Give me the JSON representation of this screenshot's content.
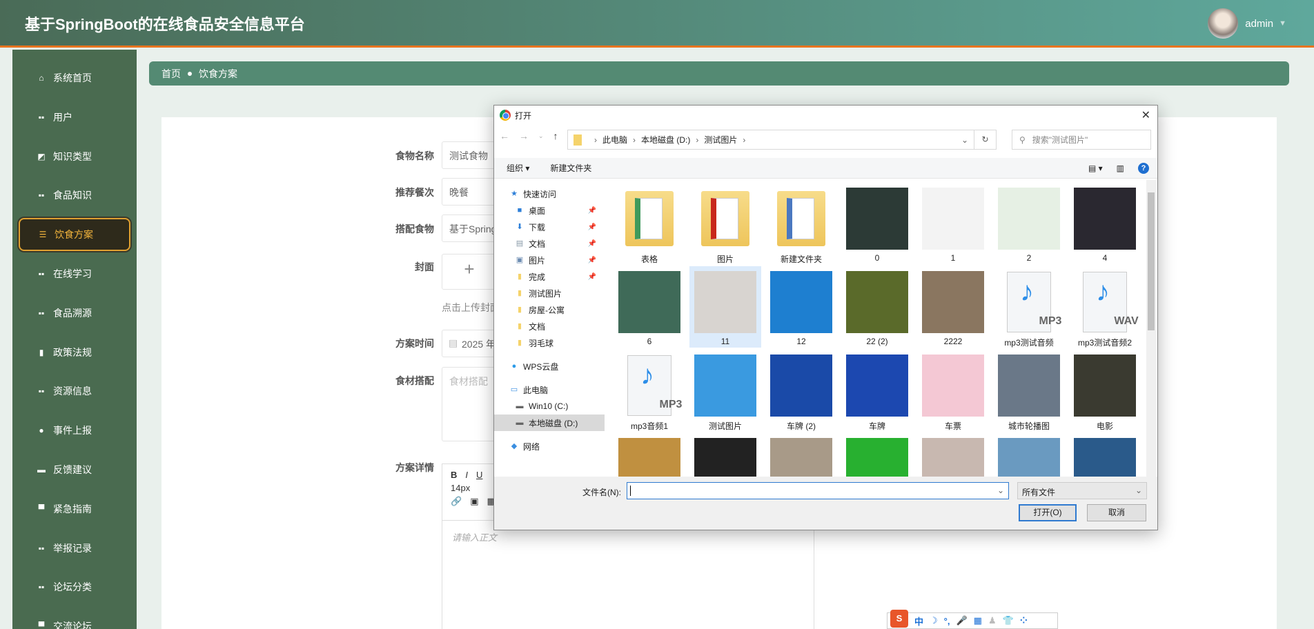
{
  "header": {
    "title": "基于SpringBoot的在线食品安全信息平台",
    "user": "admin"
  },
  "sidebar": {
    "items": [
      {
        "label": "系统首页",
        "icon": "home-icon"
      },
      {
        "label": "用户",
        "icon": "grid-icon"
      },
      {
        "label": "知识类型",
        "icon": "chart-icon"
      },
      {
        "label": "食品知识",
        "icon": "grid-icon"
      },
      {
        "label": "饮食方案",
        "icon": "sliders-icon",
        "active": true
      },
      {
        "label": "在线学习",
        "icon": "grid-icon"
      },
      {
        "label": "食品溯源",
        "icon": "grid-icon"
      },
      {
        "label": "政策法规",
        "icon": "book-icon"
      },
      {
        "label": "资源信息",
        "icon": "grid-icon"
      },
      {
        "label": "事件上报",
        "icon": "user-icon"
      },
      {
        "label": "反馈建议",
        "icon": "printer-icon"
      },
      {
        "label": "紧急指南",
        "icon": "briefcase-icon"
      },
      {
        "label": "举报记录",
        "icon": "grid-icon"
      },
      {
        "label": "论坛分类",
        "icon": "grid-icon"
      },
      {
        "label": "交流论坛",
        "icon": "forum-icon"
      }
    ]
  },
  "breadcrumb": {
    "home": "首页",
    "current": "饮食方案"
  },
  "form": {
    "food_name": {
      "label": "食物名称",
      "value": "测试食物"
    },
    "meal": {
      "label": "推荐餐次",
      "value": "晚餐"
    },
    "pair_food": {
      "label": "搭配食物",
      "value": "基于Spring"
    },
    "cover": {
      "label": "封面",
      "hint": "点击上传封面"
    },
    "plan_time": {
      "label": "方案时间",
      "value": "2025 年"
    },
    "ingredients": {
      "label": "食材搭配",
      "placeholder": "食材搭配"
    },
    "details": {
      "label": "方案详情",
      "font_size": "14px",
      "placeholder": "请输入正文"
    }
  },
  "dialog": {
    "title": "打开",
    "path": [
      "此电脑",
      "本地磁盘 (D:)",
      "测试图片"
    ],
    "search_placeholder": "搜索\"测试图片\"",
    "organize": "组织 ▾",
    "new_folder": "新建文件夹",
    "nav": [
      {
        "label": "快速访问",
        "icon": "star-icon",
        "color": "#2d7fd8",
        "level": 0
      },
      {
        "label": "桌面",
        "icon": "desktop-icon",
        "color": "#2d7fd8",
        "level": 1,
        "pinned": true
      },
      {
        "label": "下载",
        "icon": "download-icon",
        "color": "#2d7fd8",
        "level": 1,
        "pinned": true
      },
      {
        "label": "文档",
        "icon": "document-icon",
        "color": "#8a9aa8",
        "level": 1,
        "pinned": true
      },
      {
        "label": "图片",
        "icon": "picture-icon",
        "color": "#6a8ab0",
        "level": 1,
        "pinned": true
      },
      {
        "label": "完成",
        "icon": "folder-icon",
        "color": "#f5d36b",
        "level": 1,
        "pinned": true
      },
      {
        "label": "测试图片",
        "icon": "folder-icon",
        "color": "#f5d36b",
        "level": 1
      },
      {
        "label": "房屋-公寓",
        "icon": "folder-icon",
        "color": "#f5d36b",
        "level": 1
      },
      {
        "label": "文档",
        "icon": "folder-icon",
        "color": "#f5d36b",
        "level": 1
      },
      {
        "label": "羽毛球",
        "icon": "folder-icon",
        "color": "#f5d36b",
        "level": 1
      },
      {
        "label": "",
        "gap": true
      },
      {
        "label": "WPS云盘",
        "icon": "cloud-icon",
        "color": "#2d9be8",
        "level": 0
      },
      {
        "label": "",
        "gap": true
      },
      {
        "label": "此电脑",
        "icon": "computer-icon",
        "color": "#3a8ee0",
        "level": 0
      },
      {
        "label": "Win10 (C:)",
        "icon": "drive-icon",
        "color": "#666",
        "level": 1
      },
      {
        "label": "本地磁盘 (D:)",
        "icon": "drive-icon",
        "color": "#666",
        "level": 1,
        "selected": true
      },
      {
        "label": "",
        "gap": true
      },
      {
        "label": "网络",
        "icon": "network-icon",
        "color": "#3a8ee0",
        "level": 0
      }
    ],
    "files": [
      {
        "name": "表格",
        "kind": "folder",
        "color": "#3f9a5c"
      },
      {
        "name": "图片",
        "kind": "folder",
        "color": "#c8281c"
      },
      {
        "name": "新建文件夹",
        "kind": "folder",
        "color": "#4a78c0"
      },
      {
        "name": "0",
        "kind": "photo",
        "color": "#2c3a36"
      },
      {
        "name": "1",
        "kind": "photo",
        "color": "#f3f3f3"
      },
      {
        "name": "2",
        "kind": "photo",
        "color": "#e6f0e4"
      },
      {
        "name": "4",
        "kind": "photo",
        "color": "#2a2830"
      },
      {
        "name": "6",
        "kind": "photo",
        "color": "#3f6a58"
      },
      {
        "name": "11",
        "kind": "photo",
        "color": "#d8d4d0",
        "selected": true
      },
      {
        "name": "12",
        "kind": "photo",
        "color": "#1e7fd0"
      },
      {
        "name": "22 (2)",
        "kind": "photo",
        "color": "#5a6a2a"
      },
      {
        "name": "2222",
        "kind": "photo",
        "color": "#8a7660"
      },
      {
        "name": "mp3测试音频",
        "kind": "audio",
        "ext": "MP3"
      },
      {
        "name": "mp3测试音频2",
        "kind": "audio",
        "ext": "WAV"
      },
      {
        "name": "mp3音频1",
        "kind": "audio",
        "ext": "MP3"
      },
      {
        "name": "测试图片",
        "kind": "photo",
        "color": "#3a9ae0"
      },
      {
        "name": "车牌 (2)",
        "kind": "photo",
        "color": "#1a4aa8"
      },
      {
        "name": "车牌",
        "kind": "photo",
        "color": "#1c48b0"
      },
      {
        "name": "车票",
        "kind": "photo",
        "color": "#f4c8d4"
      },
      {
        "name": "城市轮播图",
        "kind": "photo",
        "color": "#6a7888"
      },
      {
        "name": "电影",
        "kind": "photo",
        "color": "#3a3a30"
      },
      {
        "name": "",
        "kind": "photo",
        "color": "#c09040"
      },
      {
        "name": "",
        "kind": "photo",
        "color": "#222222"
      },
      {
        "name": "",
        "kind": "photo",
        "color": "#a89a88"
      },
      {
        "name": "",
        "kind": "photo",
        "color": "#28b030"
      },
      {
        "name": "",
        "kind": "photo",
        "color": "#c8b8b0"
      },
      {
        "name": "",
        "kind": "photo",
        "color": "#6a9ac0"
      },
      {
        "name": "",
        "kind": "photo",
        "color": "#2a5a8a"
      }
    ],
    "filename_label": "文件名(N):",
    "filename_value": "",
    "filter": "所有文件",
    "open_button": "打开(O)",
    "cancel_button": "取消"
  },
  "ime": {
    "logo": "S",
    "mode": "中"
  }
}
